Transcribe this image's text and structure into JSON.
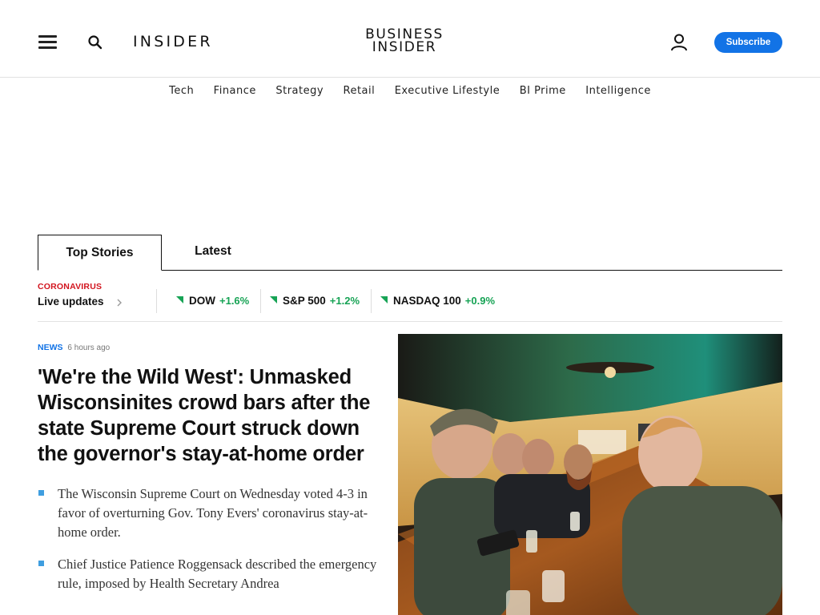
{
  "header": {
    "brand_wordmark": "INSIDER",
    "logo_line1": "BUSINESS",
    "logo_line2": "INSIDER",
    "subscribe_label": "Subscribe",
    "accent_color": "#1273e6"
  },
  "icons": {
    "menu": "hamburger-icon",
    "search": "search-icon",
    "account": "user-icon",
    "chevron": "chevron-right-icon",
    "ticker_up": "triangle-up-icon"
  },
  "section_nav": [
    "Tech",
    "Finance",
    "Strategy",
    "Retail",
    "Executive Lifestyle",
    "BI Prime",
    "Intelligence"
  ],
  "tabs": {
    "top_stories": "Top Stories",
    "latest": "Latest"
  },
  "ticker_bar": {
    "kicker": "CORONAVIRUS",
    "live_label": "Live updates",
    "kicker_color": "#d2141e",
    "up_color": "#17a355",
    "tickers": [
      {
        "name": "DOW",
        "change": "+1.6%"
      },
      {
        "name": "S&P 500",
        "change": "+1.2%"
      },
      {
        "name": "NASDAQ 100",
        "change": "+0.9%"
      }
    ]
  },
  "story": {
    "kicker": "NEWS",
    "time": "6 hours ago",
    "headline": "'We're the Wild West': Unmasked Wisconsinites crowd bars after the state Supreme Court struck down the governor's stay-at-home order",
    "bullets": [
      "The Wisconsin Supreme Court on Wednesday voted 4-3 in favor of overturning Gov. Tony Evers' coronavirus stay-at-home order.",
      "Chief Justice Patience Roggensack described the emergency rule, imposed by Health Secretary Andrea"
    ]
  }
}
